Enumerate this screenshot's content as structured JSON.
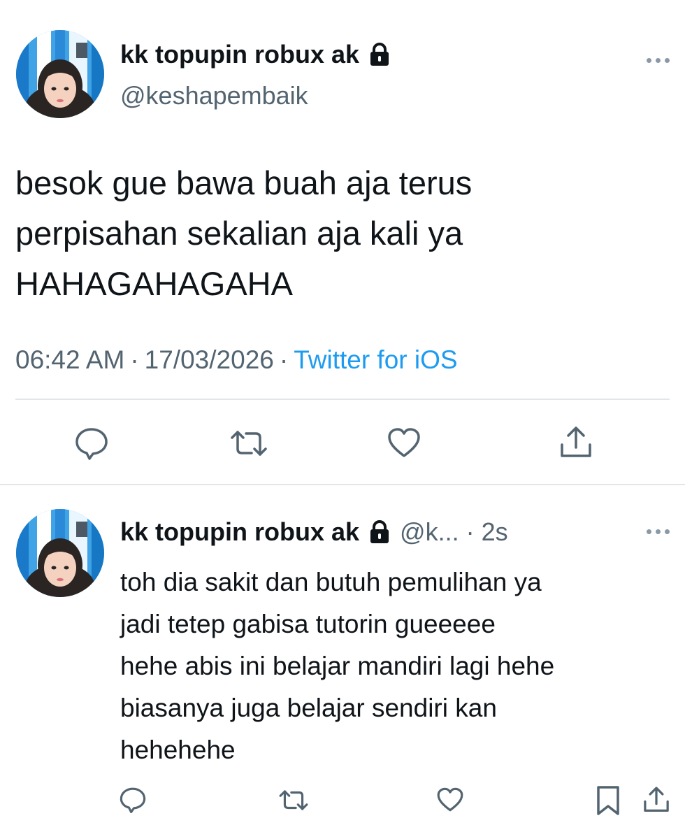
{
  "tweet": {
    "author_name": "kk topupin robux ak",
    "handle": "@keshapembaik",
    "text": "besok gue bawa buah aja terus\nperpisahan sekalian aja kali ya\nHAHAGAHAGAHA",
    "time": "06:42 AM",
    "date": "17/03/2026",
    "source": "Twitter for iOS",
    "separator": "·",
    "protected": true
  },
  "reply": {
    "author_name": "kk topupin robux ak",
    "handle": "@k...",
    "separator": "·",
    "time_ago": "2s",
    "text": "toh dia sakit dan butuh pemulihan ya\njadi tetep gabisa tutorin gueeeee\nhehe abis ini belajar mandiri lagi hehe\nbiasanya juga belajar sendiri kan\nhehehehe",
    "protected": true
  },
  "icons": {
    "reply": "comment-icon",
    "retweet": "retweet-icon",
    "like": "heart-icon",
    "share": "share-icon",
    "bookmark": "bookmark-icon",
    "more": "more-dots-icon",
    "lock": "lock-icon"
  },
  "colors": {
    "text_primary": "#0f1419",
    "text_secondary": "#536471",
    "link": "#1d9bf0",
    "divider": "#e1e6ea",
    "icon": "#536471"
  }
}
